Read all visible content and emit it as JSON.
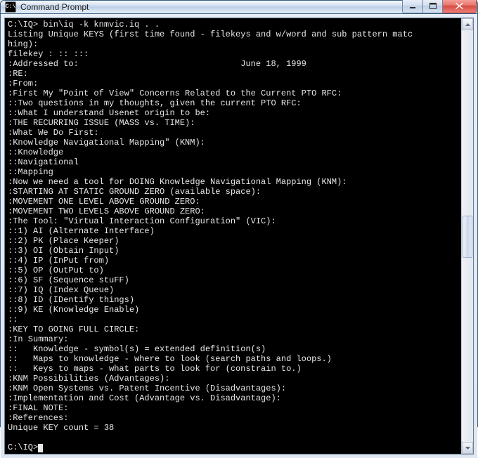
{
  "window": {
    "title": "Command Prompt",
    "icon_label": "C:\\"
  },
  "terminal": {
    "lines": [
      "C:\\IQ> bin\\iq -k knmvic.iq . .",
      "Listing Unique KEYS (first time found - filekeys and w/word and sub pattern matc",
      "hing):",
      "filekey : :: :::",
      ":Addressed to:                                June 18, 1999",
      ":RE:",
      ":From:",
      ":First My \"Point of View\" Concerns Related to the Current PTO RFC:",
      "::Two questions in my thoughts, given the current PTO RFC:",
      "::What I understand Usenet origin to be:",
      ":THE RECURRING ISSUE (MASS vs. TIME):",
      ":What We Do First:",
      ":Knowledge Navigational Mapping\" (KNM):",
      "::Knowledge",
      "::Navigational",
      "::Mapping",
      ":Now we need a tool for DOING Knowledge Navigational Mapping (KNM):",
      ":STARTING AT STATIC GROUND ZERO (available space):",
      ":MOVEMENT ONE LEVEL ABOVE GROUND ZERO:",
      ":MOVEMENT TWO LEVELS ABOVE GROUND ZERO:",
      ":The Tool: \"Virtual Interaction Configuration\" (VIC):",
      "::1) AI (Alternate Interface)",
      "::2) PK (Place Keeper)",
      "::3) OI (Obtain Input)",
      "::4) IP (InPut from)",
      "::5) OP (OutPut to)",
      "::6) SF (Sequence stuFF)",
      "::7) IQ (Index Queue)",
      "::8) ID (IDentify things)",
      "::9) KE (Knowledge Enable)",
      "::",
      ":KEY TO GOING FULL CIRCLE:",
      ":In Summary:",
      "::   Knowledge - symbol(s) = extended definition(s)",
      "::   Maps to knowledge - where to look (search paths and loops.)",
      "::   Keys to maps - what parts to look for (constrain to.)",
      ":KNM Possibilities (Advantages):",
      ":KNM Open Systems vs. Patent Incentive (Disadvantages):",
      ":Implementation and Cost (Advantage vs. Disadvantage):",
      ":FINAL NOTE:",
      ":References:",
      "Unique KEY count = 38",
      "",
      "C:\\IQ>"
    ]
  }
}
